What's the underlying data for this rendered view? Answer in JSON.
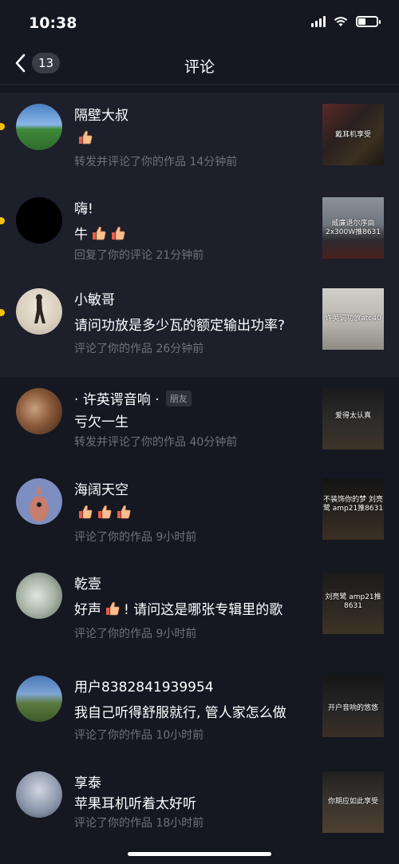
{
  "status": {
    "time": "10:38"
  },
  "nav": {
    "title": "评论",
    "badge": "13"
  },
  "items": [
    {
      "name": "隔壁大叔",
      "content": "",
      "emoji_count": 1,
      "meta": "转发并评论了你的作品  14分钟前",
      "thumb_text": "戴耳机享受",
      "unread": true,
      "tag": ""
    },
    {
      "name": "嗨!",
      "content": "牛",
      "emoji_count": 2,
      "meta": "回复了你的评论  21分钟前",
      "thumb_text": "威廉退尔序曲 2x300W推8631",
      "unread": true,
      "tag": ""
    },
    {
      "name": "小敏哥",
      "content": "请问功放是多少瓦的额定输出功率?",
      "emoji_count": 0,
      "meta": "评论了你的作品  26分钟前",
      "thumb_text": "许英调功放atc40",
      "unread": true,
      "tag": ""
    },
    {
      "name": "· 许英谔音响 ·",
      "content": "亏欠一生",
      "emoji_count": 0,
      "meta": "转发并评论了你的作品  40分钟前",
      "thumb_text": "爱得太认真",
      "unread": false,
      "tag": "朋友"
    },
    {
      "name": "海阔天空",
      "content": "",
      "emoji_count": 3,
      "meta": "评论了你的作品  9小时前",
      "thumb_text": "不装饰你的梦 刘亮鹭 amp21推8631",
      "unread": false,
      "tag": ""
    },
    {
      "name": "乾壹",
      "content": "好声",
      "content_after": "! 请问这是哪张专辑里的歌",
      "emoji_count": 1,
      "meta": "评论了你的作品  9小时前",
      "thumb_text": "刘亮鹭 amp21推8631",
      "unread": false,
      "tag": ""
    },
    {
      "name": "用户8382841939954",
      "content": "我自己听得舒服就行, 管人家怎么做",
      "emoji_count": 0,
      "meta": "评论了你的作品  10小时前",
      "thumb_text": "开户音响的悠悠",
      "unread": false,
      "tag": ""
    },
    {
      "name": "享泰",
      "content": "苹果耳机听着太好听",
      "emoji_count": 0,
      "meta": "评论了你的作品  18小时前",
      "thumb_text": "你期应如此享受",
      "unread": false,
      "tag": ""
    }
  ],
  "colors": {
    "background": "#151721",
    "unread_bg": "#1d1f2b",
    "dot": "#f7c200",
    "meta": "#6f717c"
  },
  "icons": [
    "back-chevron-icon",
    "thumbs-up-icon",
    "signal-icon",
    "wifi-icon",
    "battery-icon"
  ]
}
